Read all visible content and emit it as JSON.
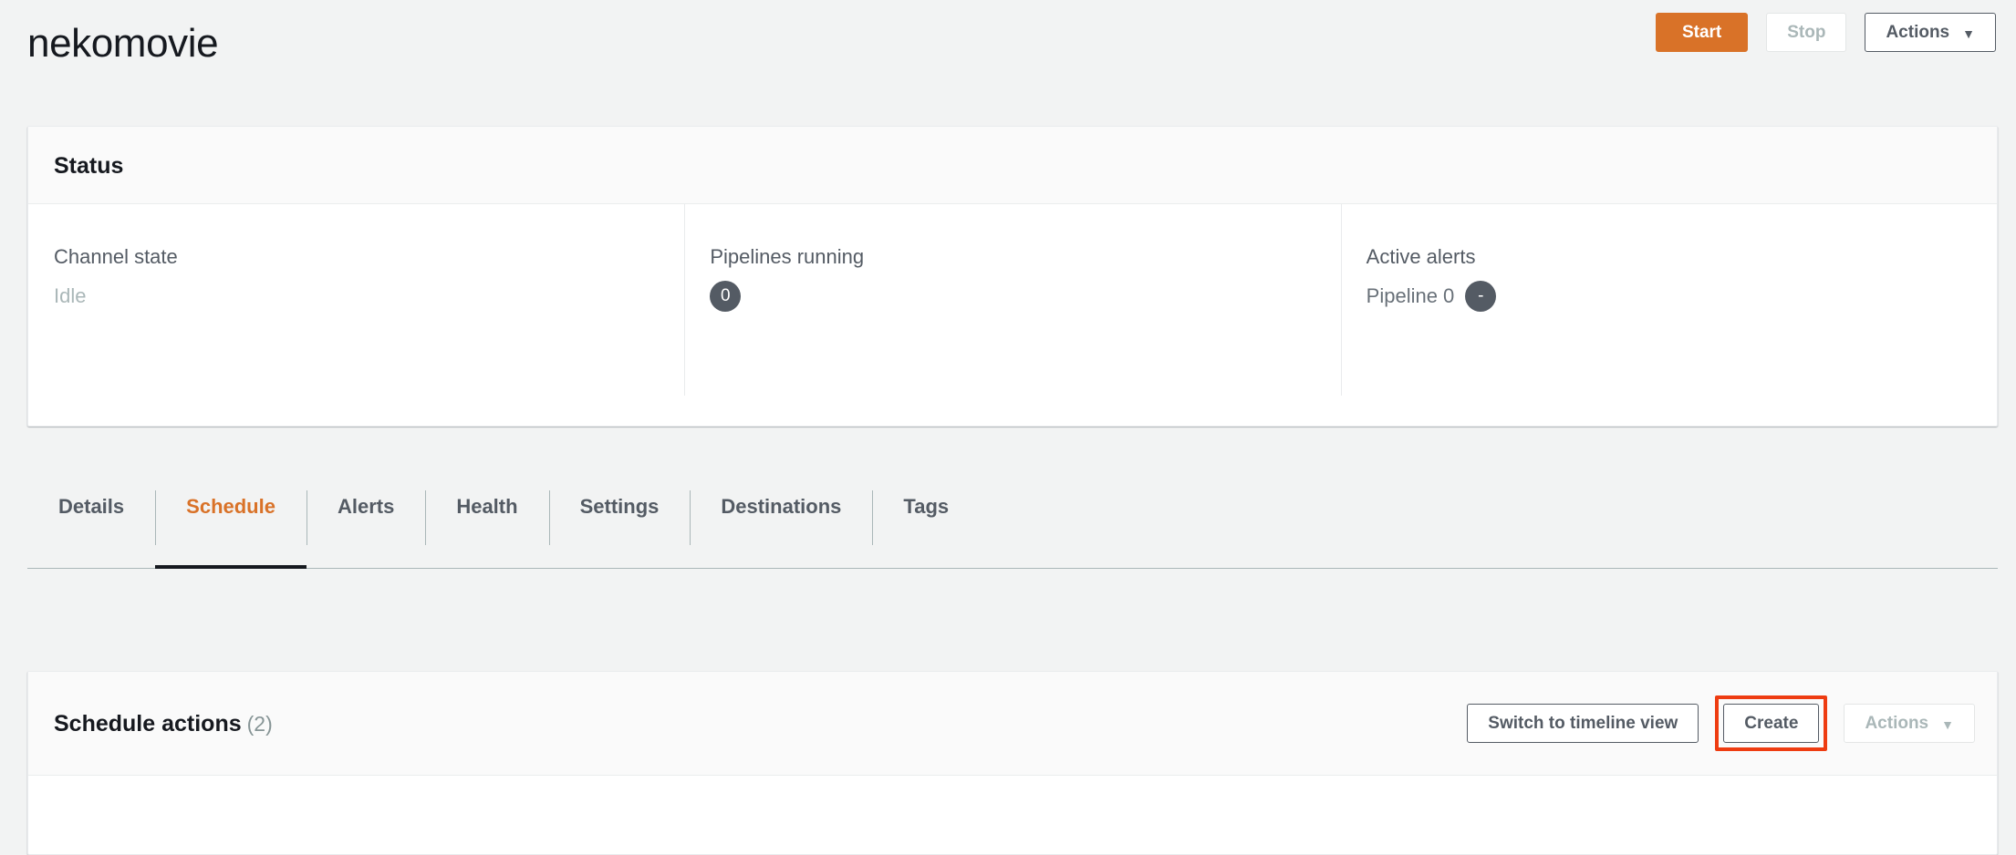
{
  "header": {
    "title": "nekomovie",
    "buttons": [
      {
        "label": "Start",
        "style": "primary",
        "name": "start-button"
      },
      {
        "label": "Stop",
        "style": "disabled",
        "name": "stop-button"
      },
      {
        "label": "Actions",
        "style": "default",
        "caret": "▼",
        "name": "actions-menu-button"
      }
    ]
  },
  "status_card": {
    "title": "Status",
    "columns": [
      {
        "label": "Channel state",
        "value": "Idle",
        "badge": null
      },
      {
        "label": "Pipelines running",
        "value": "",
        "badge": "0"
      },
      {
        "label": "Active alerts",
        "value": "Pipeline 0",
        "badge": "-"
      }
    ]
  },
  "tabs": [
    {
      "label": "Details",
      "active": false
    },
    {
      "label": "Schedule",
      "active": true
    },
    {
      "label": "Alerts",
      "active": false
    },
    {
      "label": "Health",
      "active": false
    },
    {
      "label": "Settings",
      "active": false
    },
    {
      "label": "Destinations",
      "active": false
    },
    {
      "label": "Tags",
      "active": false
    }
  ],
  "schedule_card": {
    "title": "Schedule actions",
    "count": "(2)",
    "buttons": {
      "switch_view": "Switch to timeline view",
      "create": "Create",
      "actions": "Actions",
      "actions_caret": "▼"
    }
  },
  "colors": {
    "accent_orange": "#d97228",
    "annotation_red": "#ee3c11",
    "text_dark": "#16191f",
    "text_secondary": "#545b64",
    "text_muted": "#aab7b8",
    "page_background": "#f2f3f3"
  }
}
